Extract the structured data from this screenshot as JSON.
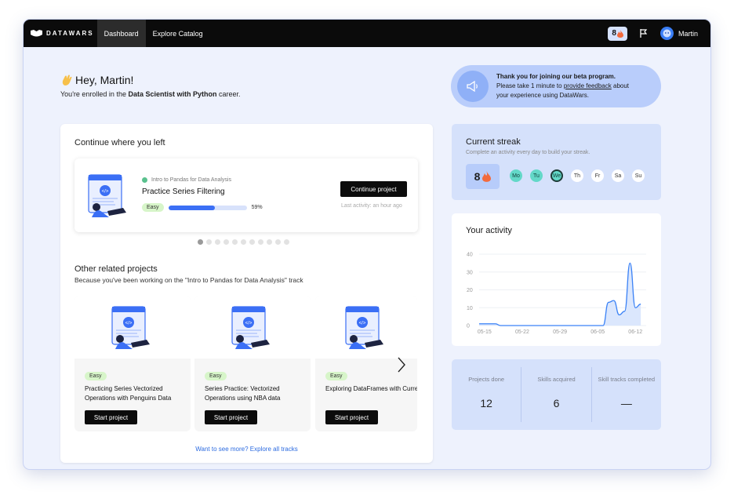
{
  "nav": {
    "brand": "DATAWARS",
    "tabs": [
      {
        "label": "Dashboard"
      },
      {
        "label": "Explore Catalog"
      }
    ],
    "streak_count": "8",
    "user_name": "Martin"
  },
  "greeting": {
    "title": "Hey, Martin!",
    "enrolled_prefix": "You're enrolled in the ",
    "career": "Data Scientist with Python",
    "enrolled_suffix": " career."
  },
  "beta": {
    "title": "Thank you for joining our beta program.",
    "line2_prefix": "Please take 1 minute to ",
    "link": "provide feedback",
    "line2_suffix": " about",
    "line3": "your experience using DataWars."
  },
  "continue_section": {
    "title": "Continue where you left",
    "track": "Intro to Pandas for Data Analysis",
    "project": "Practice Series Filtering",
    "difficulty": "Easy",
    "progress_percent": 59,
    "progress_label": "59%",
    "button": "Continue project",
    "last_activity": "Last activity: an hour ago"
  },
  "related": {
    "title": "Other related projects",
    "subtitle": "Because you've been working on the \"Intro to Pandas for Data Analysis\" track",
    "projects": [
      {
        "difficulty": "Easy",
        "title": "Practicing Series Vectorized Operations with Penguins Data",
        "button": "Start project"
      },
      {
        "difficulty": "Easy",
        "title": "Series Practice: Vectorized Operations using NBA data",
        "button": "Start project"
      },
      {
        "difficulty": "Easy",
        "title": "Exploring DataFrames with Currency Data",
        "button": "Start project"
      }
    ],
    "explore_link": "Want to see more? Explore all tracks"
  },
  "streak": {
    "title": "Current streak",
    "subtitle": "Complete an activity every day to build your streak.",
    "count": "8",
    "days": [
      {
        "label": "Mo",
        "state": "done"
      },
      {
        "label": "Tu",
        "state": "done"
      },
      {
        "label": "We",
        "state": "today"
      },
      {
        "label": "Th",
        "state": "pending"
      },
      {
        "label": "Fr",
        "state": "pending"
      },
      {
        "label": "Sa",
        "state": "pending"
      },
      {
        "label": "Su",
        "state": "pending"
      }
    ]
  },
  "activity": {
    "title": "Your activity"
  },
  "chart_data": {
    "type": "area",
    "title": "Your activity",
    "x_ticks": [
      "05-15",
      "05-22",
      "05-29",
      "06-05",
      "06-12"
    ],
    "y_ticks": [
      0,
      10,
      20,
      30,
      40
    ],
    "ylim": [
      0,
      40
    ],
    "series": [
      {
        "values": [
          {
            "x": "05-14",
            "y": 1
          },
          {
            "x": "05-17",
            "y": 1
          },
          {
            "x": "05-18",
            "y": 0
          },
          {
            "x": "06-06",
            "y": 0
          },
          {
            "x": "06-07",
            "y": 13
          },
          {
            "x": "06-08",
            "y": 14
          },
          {
            "x": "06-09",
            "y": 6
          },
          {
            "x": "06-10",
            "y": 8
          },
          {
            "x": "06-11",
            "y": 35
          },
          {
            "x": "06-12",
            "y": 10
          },
          {
            "x": "06-13",
            "y": 12
          }
        ]
      }
    ],
    "colors": {
      "line": "#3b82f6",
      "fill": "#dbe7fd"
    }
  },
  "stats": [
    {
      "label": "Projects done",
      "value": "12"
    },
    {
      "label": "Skills acquired",
      "value": "6"
    },
    {
      "label": "Skill tracks completed",
      "value": "—"
    }
  ]
}
